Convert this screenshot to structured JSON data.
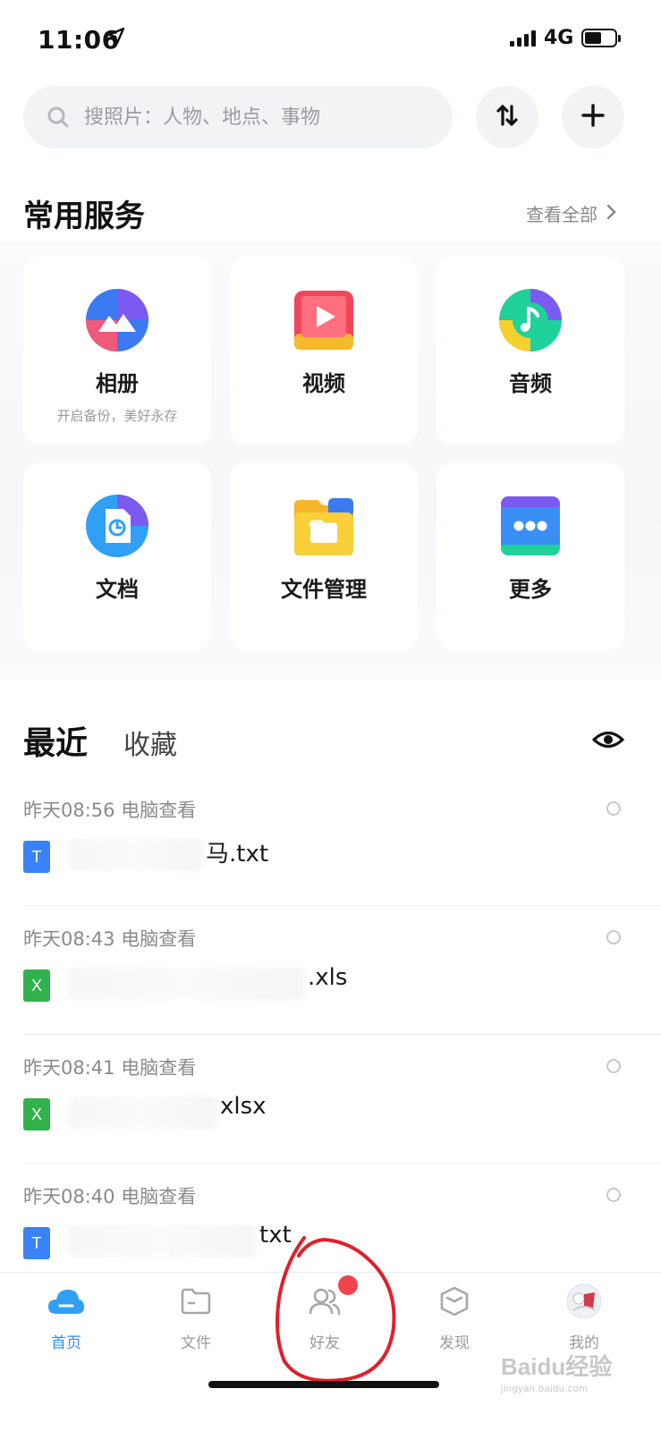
{
  "status_bar": {
    "time": "11:06",
    "network": "4G"
  },
  "search": {
    "placeholder": "搜照片：人物、地点、事物"
  },
  "services": {
    "title": "常用服务",
    "see_all": "查看全部",
    "items": [
      {
        "label": "相册",
        "sub": "开启备份，美好永存",
        "icon": "album-icon"
      },
      {
        "label": "视频",
        "icon": "video-icon"
      },
      {
        "label": "音频",
        "icon": "audio-icon"
      },
      {
        "label": "文档",
        "icon": "document-icon"
      },
      {
        "label": "文件管理",
        "icon": "folder-icon"
      },
      {
        "label": "更多",
        "icon": "more-icon"
      }
    ]
  },
  "recent": {
    "tab_recent": "最近",
    "tab_favorites": "收藏",
    "items": [
      {
        "meta": "昨天08:56 电脑查看",
        "name_visible": "马.txt",
        "type": "txt",
        "type_glyph": "T"
      },
      {
        "meta": "昨天08:43 电脑查看",
        "name_visible": ".xls",
        "type": "xls",
        "type_glyph": "X"
      },
      {
        "meta": "昨天08:41 电脑查看",
        "name_visible": "xlsx",
        "type": "xls",
        "type_glyph": "X"
      },
      {
        "meta": "昨天08:40 电脑查看",
        "name_visible": "txt",
        "type": "txt",
        "type_glyph": "T"
      }
    ]
  },
  "tabbar": {
    "items": [
      {
        "label": "首页",
        "active": true
      },
      {
        "label": "文件"
      },
      {
        "label": "好友"
      },
      {
        "label": "发现"
      },
      {
        "label": "我的"
      }
    ]
  },
  "watermark": {
    "brand": "Baidu经验",
    "url": "jingyan.baidu.com"
  },
  "colors": {
    "accent": "#2f8cf5",
    "badge": "#f2424b",
    "annotation": "#e0202a"
  }
}
